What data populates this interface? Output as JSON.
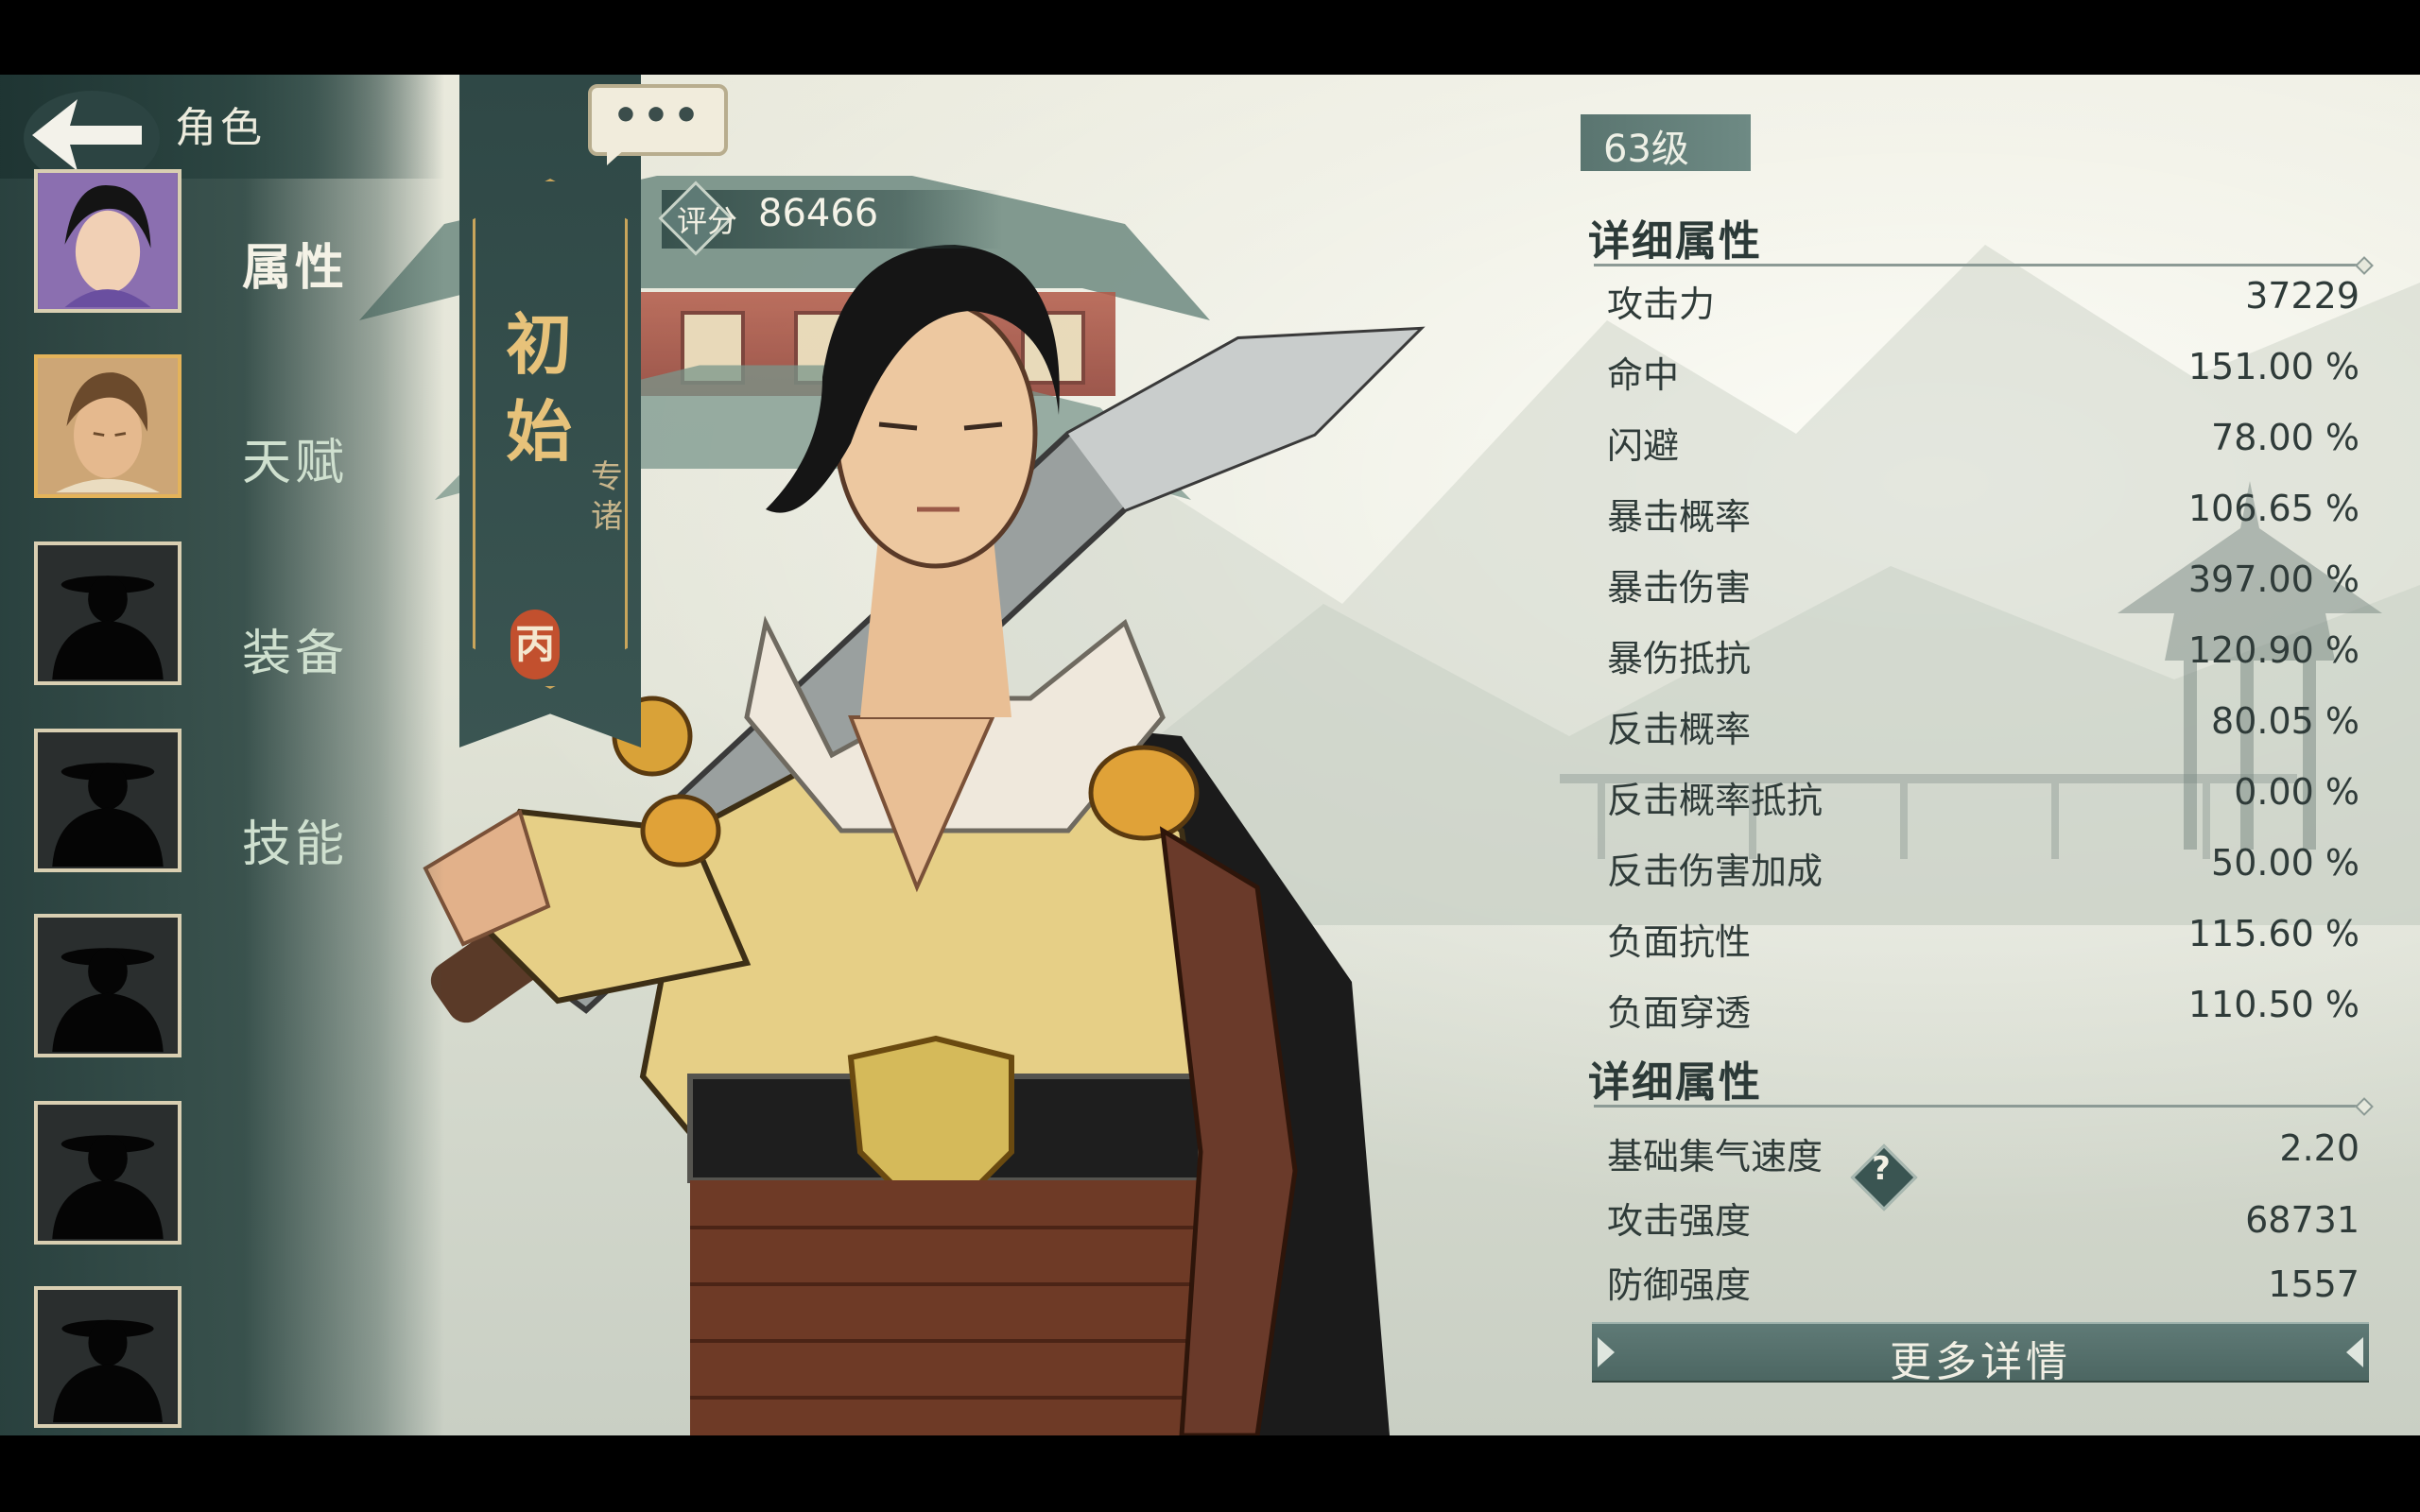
{
  "header": {
    "title": "角色",
    "back_icon": "back-arrow-icon",
    "chat_icon": "ellipsis-icon",
    "chat_dots": "•••"
  },
  "sidebar": {
    "menu": [
      {
        "label": "属性",
        "active": true
      },
      {
        "label": "天赋",
        "active": false
      },
      {
        "label": "装备",
        "active": false
      },
      {
        "label": "技能",
        "active": false
      }
    ],
    "portraits": [
      {
        "type": "female-character",
        "selected": false
      },
      {
        "type": "male-character",
        "selected": true
      },
      {
        "type": "locked-silhouette"
      },
      {
        "type": "locked-silhouette"
      },
      {
        "type": "locked-silhouette"
      },
      {
        "type": "locked-silhouette"
      },
      {
        "type": "locked-silhouette"
      }
    ]
  },
  "character": {
    "name": "初始",
    "name_chars": [
      "初",
      "始"
    ],
    "subtitle": "专诸",
    "subtitle_chars": [
      "专",
      "诸"
    ],
    "grade": "丙",
    "score_label": "评分",
    "score": "86466"
  },
  "stats": {
    "level": "63级",
    "section1_title": "详细属性",
    "section1": [
      {
        "label": "攻击力",
        "value": "37229"
      },
      {
        "label": "命中",
        "value": "151.00 %"
      },
      {
        "label": "闪避",
        "value": "78.00 %"
      },
      {
        "label": "暴击概率",
        "value": "106.65 %"
      },
      {
        "label": "暴击伤害",
        "value": "397.00 %"
      },
      {
        "label": "暴伤抵抗",
        "value": "120.90 %"
      },
      {
        "label": "反击概率",
        "value": "80.05 %"
      },
      {
        "label": "反击概率抵抗",
        "value": "0.00 %"
      },
      {
        "label": "反击伤害加成",
        "value": "50.00 %"
      },
      {
        "label": "负面抗性",
        "value": "115.60 %"
      },
      {
        "label": "负面穿透",
        "value": "110.50 %"
      }
    ],
    "section2_title": "详细属性",
    "section2": [
      {
        "label": "基础集气速度",
        "value": "2.20",
        "help": "?"
      },
      {
        "label": "攻击强度",
        "value": "68731"
      },
      {
        "label": "防御强度",
        "value": "1557"
      }
    ],
    "more_label": "更多详情"
  },
  "colors": {
    "accent_teal": "#3a5552",
    "gold": "#e4b35a",
    "grade_red": "#c2502e"
  }
}
